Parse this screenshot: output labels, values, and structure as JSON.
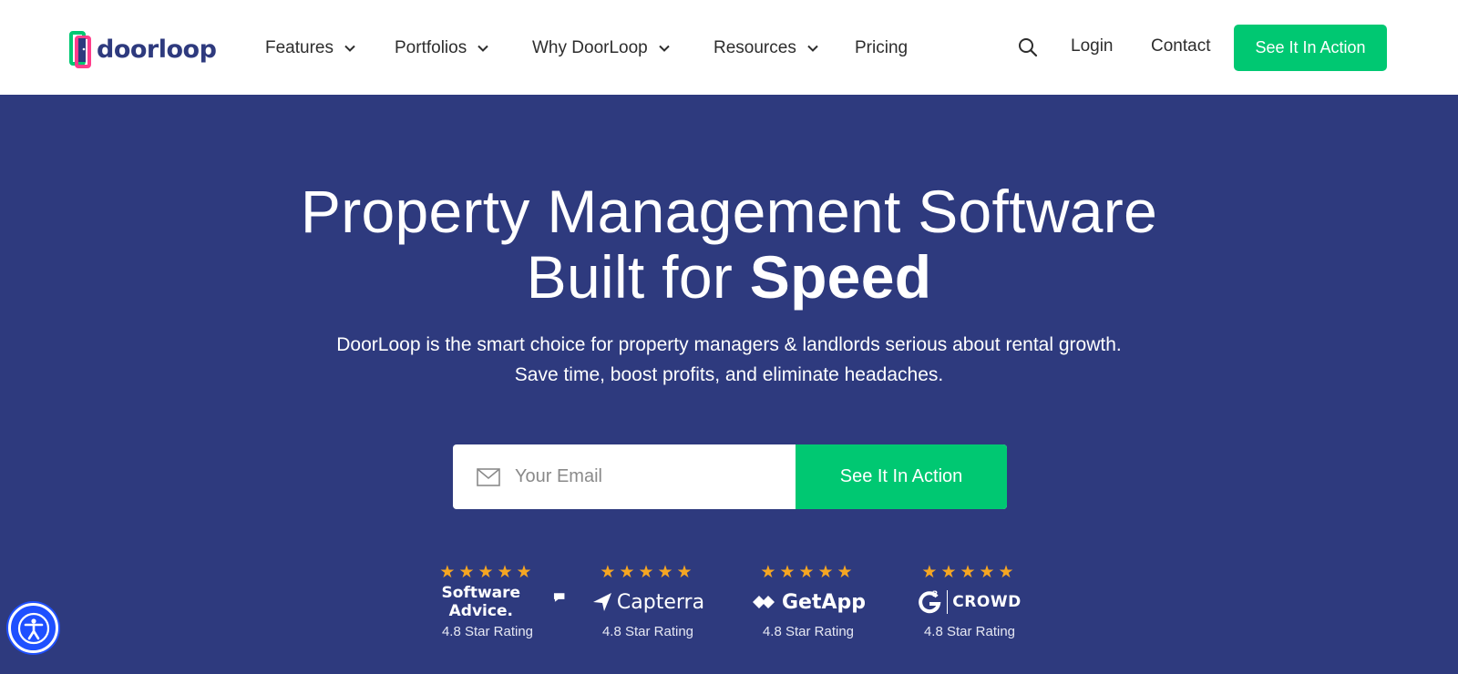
{
  "header": {
    "logo_text": "doorloop",
    "nav": [
      {
        "label": "Features",
        "has_dropdown": true
      },
      {
        "label": "Portfolios",
        "has_dropdown": true
      },
      {
        "label": "Why DoorLoop",
        "has_dropdown": true
      },
      {
        "label": "Resources",
        "has_dropdown": true
      },
      {
        "label": "Pricing",
        "has_dropdown": false
      }
    ],
    "login": "Login",
    "contact": "Contact",
    "cta": "See It In Action"
  },
  "hero": {
    "title_line1": "Property Management Software",
    "title_line2_prefix": "Built for ",
    "title_line2_bold": "Speed",
    "subtitle_line1": "DoorLoop is the smart choice for property managers & landlords serious about rental growth.",
    "subtitle_line2": "Save time, boost profits, and eliminate headaches.",
    "email_placeholder": "Your Email",
    "email_value": "",
    "cta": "See It In Action"
  },
  "ratings": [
    {
      "stars": "★★★★★",
      "brand": "Software Advice.",
      "label": "4.8 Star Rating"
    },
    {
      "stars": "★★★★★",
      "brand": "Capterra",
      "label": "4.8 Star Rating"
    },
    {
      "stars": "★★★★★",
      "brand": "GetApp",
      "label": "4.8 Star Rating"
    },
    {
      "stars": "★★★★★",
      "brand": "CROWD",
      "label": "4.8 Star Rating"
    }
  ],
  "colors": {
    "brand_navy": "#2e3a7e",
    "accent_green": "#00c872",
    "star_gold": "#f5a623",
    "accessibility_blue": "#1f50ff"
  },
  "icons": {
    "search": "search-icon",
    "dropdown": "chevron-down-icon",
    "email": "mail-icon",
    "accessibility": "accessibility-icon"
  }
}
